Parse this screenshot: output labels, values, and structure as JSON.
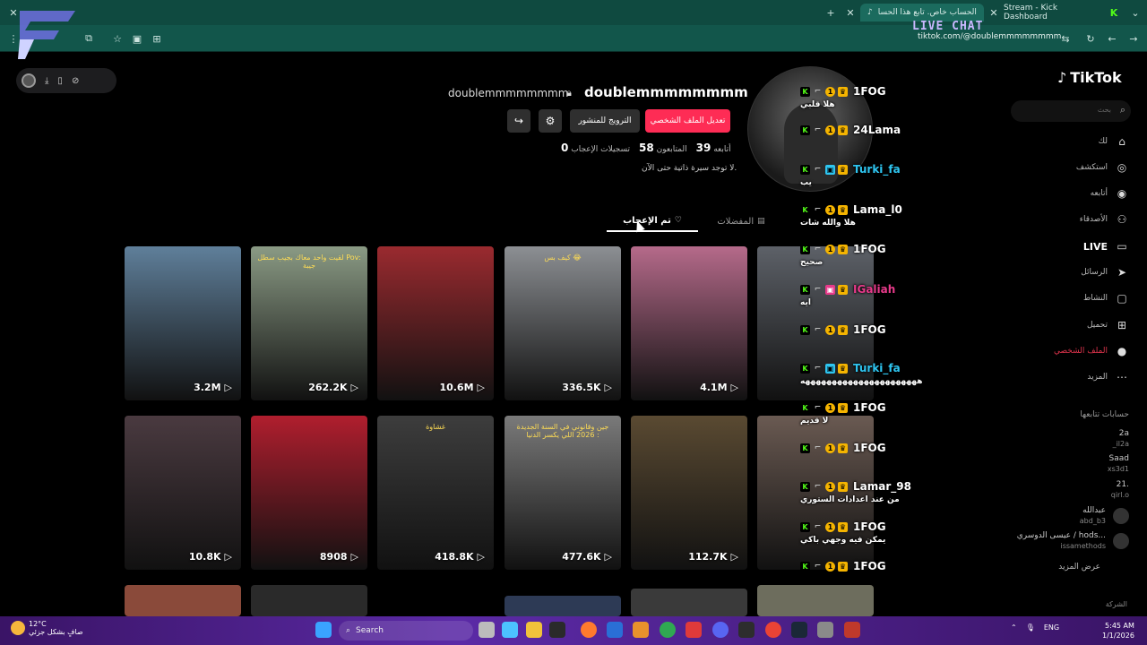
{
  "browser": {
    "tabs": [
      {
        "title": "هذا الحساب خاص. تابع هذا الحسا"
      },
      {
        "title": "Stream - Kick Dashboard"
      }
    ],
    "url": "tiktok.com/@doublemmmmmmmm"
  },
  "overlay": {
    "live_chat_label": "LIVE CHAT"
  },
  "tiktok": {
    "brand": "TikTok",
    "search_placeholder": "بحث",
    "nav": [
      {
        "label": "لك",
        "icon": "home-icon"
      },
      {
        "label": "استكشف",
        "icon": "compass-icon"
      },
      {
        "label": "أتابعه",
        "icon": "following-icon"
      },
      {
        "label": "الأصدقاء",
        "icon": "friends-icon"
      },
      {
        "label": "LIVE",
        "icon": "live-icon"
      },
      {
        "label": "الرسائل",
        "icon": "messages-icon"
      },
      {
        "label": "النشاط",
        "icon": "activity-icon"
      },
      {
        "label": "تحميل",
        "icon": "upload-icon"
      },
      {
        "label": "الملف الشخصي",
        "icon": "profile-icon"
      },
      {
        "label": "المزيد",
        "icon": "more-icon"
      }
    ],
    "following_header": "حسابات تتابعها",
    "following": [
      {
        "name": "2a",
        "handle": "_il2a"
      },
      {
        "name": "Saad",
        "handle": "xs3d1"
      },
      {
        "name": "21.",
        "handle": "qirl.o"
      },
      {
        "name": "عبدالله",
        "handle": "abd_b3"
      },
      {
        "name": "عيسى الدوسري / hods...",
        "handle": "issamethods"
      }
    ],
    "see_more": "عرض المزيد",
    "footer": "الشركة"
  },
  "profile": {
    "username": "doublemmmmmmmm",
    "nickname": "doublemmmmmmmm",
    "edit_button": "تعديل الملف الشخصي",
    "promote_button": "الترويج للمنشور",
    "following_count": "39",
    "following_label": "أتابعه",
    "followers_count": "58",
    "followers_label": "المتابعون",
    "likes_count": "0",
    "likes_label": "تسجيلات الإعجاب",
    "bio": "لا توجد سيرة ذاتية حتى الآن.",
    "tab_liked": "تم الإعجاب",
    "tab_favorites": "المفضلات"
  },
  "videos": [
    {
      "views": "3.2M",
      "color": "#5f7f9a",
      "caption": ""
    },
    {
      "views": "262.2K",
      "color": "#8a9a84",
      "caption": "لقيت واحد معاك بجيب سطل Pov: جيبة"
    },
    {
      "views": "10.6M",
      "color": "#9a2a2f",
      "caption": ""
    },
    {
      "views": "336.5K",
      "color": "#8c8f93",
      "caption": "كيف بس 😂"
    },
    {
      "views": "4.1M",
      "color": "#b56a8a",
      "caption": ""
    },
    {
      "views": "",
      "color": "#5d6168",
      "caption": ""
    },
    {
      "views": "10.8K",
      "color": "#4a3a40",
      "caption": ""
    },
    {
      "views": "8908",
      "color": "#b01e2e",
      "caption": ""
    },
    {
      "views": "418.8K",
      "color": "#3d3d3d",
      "caption": "غشاوة"
    },
    {
      "views": "477.6K",
      "color": "#7a7a7a",
      "caption": "جين وقانوني في السنة الجديدة 2026 اللي يكسر الدنيا :"
    },
    {
      "views": "112.7K",
      "color": "#5a4a32",
      "caption": ""
    },
    {
      "views": "",
      "color": "#6a5a52",
      "caption": ""
    }
  ],
  "chat": [
    {
      "user": "1FOG",
      "user_color": "#ffffff",
      "text": "هلا قلبي"
    },
    {
      "user": "24Lama",
      "user_color": "#ffffff",
      "text": ""
    },
    {
      "user": "Turki_fa",
      "user_color": "#2ec5f0",
      "text": "يب"
    },
    {
      "user": "Lama_l0",
      "user_color": "#ffffff",
      "text": "هلا والله شات"
    },
    {
      "user": "1FOG",
      "user_color": "#ffffff",
      "text": "صحيح"
    },
    {
      "user": "IGaliah",
      "user_color": "#e73a8a",
      "text": "ايه"
    },
    {
      "user": "1FOG",
      "user_color": "#ffffff",
      "text": ""
    },
    {
      "user": "Turki_fa",
      "user_color": "#2ec5f0",
      "text": "ههههههههههههههههههههههه"
    },
    {
      "user": "1FOG",
      "user_color": "#ffffff",
      "text": "لا قديم"
    },
    {
      "user": "1FOG",
      "user_color": "#ffffff",
      "text": ""
    },
    {
      "user": "Lamar_98",
      "user_color": "#ffffff",
      "text": "من عند اعدادات الستوري"
    },
    {
      "user": "1FOG",
      "user_color": "#ffffff",
      "text": "يمكن فيه وجهي باكي"
    },
    {
      "user": "1FOG",
      "user_color": "#ffffff",
      "text": ""
    }
  ],
  "taskbar": {
    "temperature": "12°C",
    "weather_desc": "صافٍ بشكل جزئي",
    "search_label": "Search",
    "language": "ENG",
    "time": "5:45 AM",
    "date": "1/1/2026"
  }
}
